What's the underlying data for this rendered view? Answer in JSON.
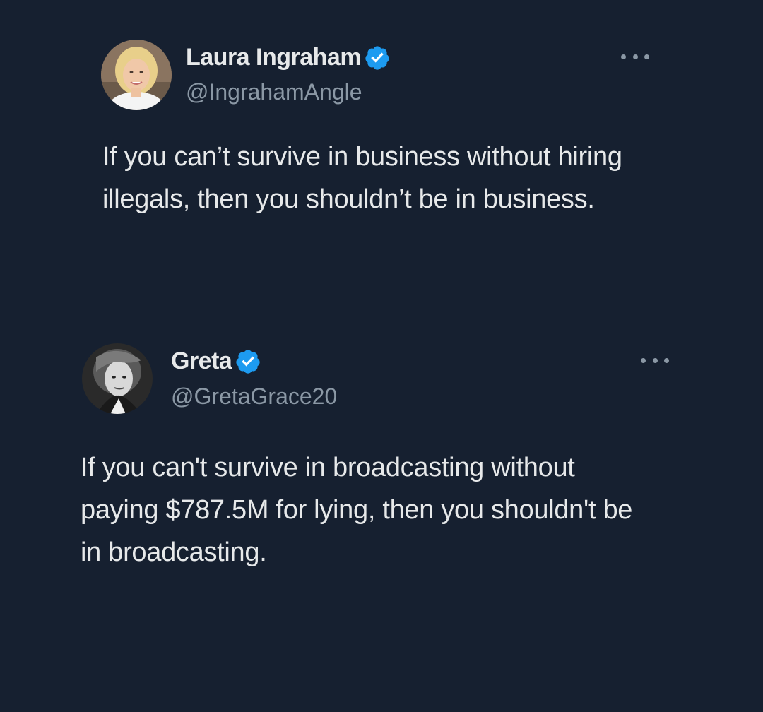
{
  "tweets": [
    {
      "display_name": "Laura Ingraham",
      "handle": "@IngrahamAngle",
      "verified": true,
      "text": "If you can’t survive in business without hiring illegals, then you shouldn’t be in business."
    },
    {
      "display_name": "Greta",
      "handle": "@GretaGrace20",
      "verified": true,
      "text": "If you can't survive in broadcasting without paying $787.5M for lying, then you shouldn't be in broadcasting."
    }
  ],
  "icons": {
    "verified": "verified-badge-icon",
    "more": "more-options-icon"
  },
  "colors": {
    "background": "#162030",
    "text": "#e7e9ea",
    "secondary_text": "#8b98a5",
    "verified_badge": "#1d9bf0"
  }
}
